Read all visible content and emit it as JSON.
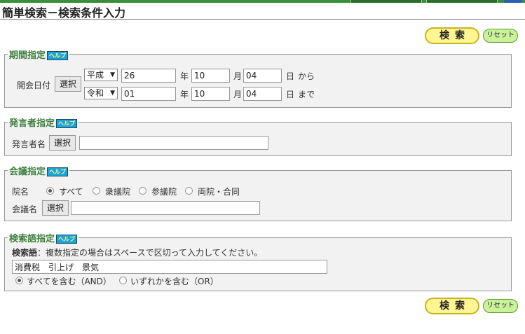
{
  "header": {
    "title": "簡単検索－検索条件入力"
  },
  "actions": {
    "search_label": "検索",
    "reset_label": "リセット"
  },
  "help_label": "ヘルプ",
  "period": {
    "legend": "期間指定",
    "date_label": "開会日付",
    "select_label": "選択",
    "from": {
      "era": "平成",
      "year": "26",
      "year_unit": "年",
      "month": "10",
      "month_unit": "月",
      "day": "04",
      "day_unit": "日",
      "suffix": "から"
    },
    "to": {
      "era": "令和",
      "year": "01",
      "year_unit": "年",
      "month": "10",
      "month_unit": "月",
      "day": "04",
      "day_unit": "日",
      "suffix": "まで"
    }
  },
  "speaker": {
    "legend": "発言者指定",
    "label": "発言者名",
    "select_label": "選択",
    "value": ""
  },
  "meeting": {
    "legend": "会議指定",
    "house_label": "院名",
    "houses": [
      "すべて",
      "衆議院",
      "参議院",
      "両院・合同"
    ],
    "selected_house": "すべて",
    "name_label": "会議名",
    "select_label": "選択",
    "value": ""
  },
  "keyword": {
    "legend": "検索語指定",
    "hint_bold": "検索語",
    "hint_rest": "：複数指定の場合はスペースで区切って入力してください。",
    "value": "消費税　引上げ　景気",
    "modes": [
      "すべてを含む（AND）",
      "いずれかを含む（OR）"
    ],
    "selected_mode": "すべてを含む（AND）"
  }
}
